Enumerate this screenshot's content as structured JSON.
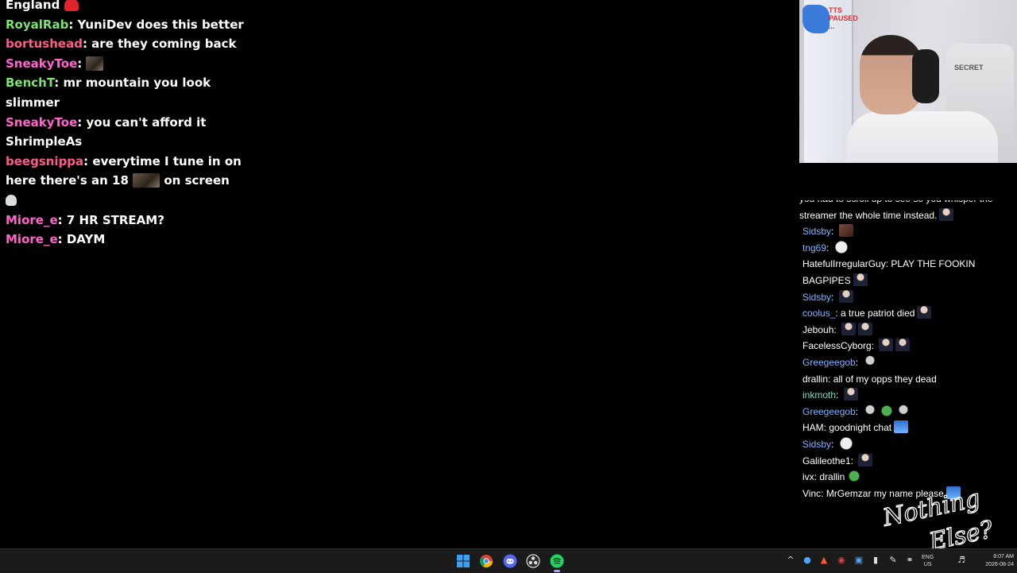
{
  "left_chat": [
    {
      "user": "",
      "user_color": "#ffffff",
      "text": "England",
      "emote": "heart"
    },
    {
      "user": "RoyalRab",
      "user_color": "#7ee36e",
      "text": "YuniDev does this better"
    },
    {
      "user": "bortushead",
      "user_color": "#ff5b8a",
      "text": "are they coming back"
    },
    {
      "user": "SneakyToe",
      "user_color": "#ff66cc",
      "text": "",
      "emote": "image"
    },
    {
      "user": "BenchT",
      "user_color": "#7ee36e",
      "text": "mr mountain you look slimmer"
    },
    {
      "user": "SneakyToe",
      "user_color": "#ff66cc",
      "text": "you can't afford it ShrimpleAs"
    },
    {
      "user": "beegsnippa",
      "user_color": "#ff5b8a",
      "text_before": "everytime I tune in on here there's an 18",
      "text_after": "on screen",
      "emote": "image-skull"
    },
    {
      "user": "Miore_e",
      "user_color": "#ff66cc",
      "text": "7 HR STREAM?"
    },
    {
      "user": "Miore_e",
      "user_color": "#ff66cc",
      "text": "DAYM"
    }
  ],
  "webcam": {
    "overlay_text": "TTS\nPAUSED\n...",
    "chair_brand": "SECRET"
  },
  "right_chat": [
    {
      "user": "",
      "text": "you had to scroll up to see so you whisper the streamer the whole time instead.",
      "emotes": [
        "face-dark"
      ],
      "partial_top": true
    },
    {
      "user": "Sidsby",
      "user_color": "#7fb2ff",
      "text": "",
      "emotes": [
        "pic"
      ]
    },
    {
      "user": "tng69",
      "user_color": "#7fb2ff",
      "text": "",
      "emotes": [
        "face"
      ]
    },
    {
      "user": "HatefulIrregularGuy",
      "user_color": "#ffffff",
      "text": "PLAY THE FOOKIN BAGPIPES",
      "emotes": [
        "face-skin"
      ]
    },
    {
      "user": "Sidsby",
      "user_color": "#7fb2ff",
      "text": "",
      "emotes": [
        "salute"
      ]
    },
    {
      "user": "coolus_",
      "user_color": "#7fb2ff",
      "text": "a true patriot died",
      "emotes": [
        "salute"
      ]
    },
    {
      "user": "Jebouh",
      "user_color": "#ffffff",
      "text": "",
      "emotes": [
        "salute",
        "salute"
      ]
    },
    {
      "user": "FacelessCyborg",
      "user_color": "#ffffff",
      "text": "",
      "emotes": [
        "salute",
        "salute"
      ]
    },
    {
      "user": "Greegeegob",
      "user_color": "#7fb2ff",
      "text": "",
      "emotes": [
        "mic"
      ]
    },
    {
      "user": "drallin",
      "user_color": "#ffffff",
      "text": "all of my opps they dead",
      "emotes": []
    },
    {
      "user": "inkmoth",
      "user_color": "#6fe0c8",
      "text": "",
      "emotes": [
        "salute"
      ]
    },
    {
      "user": "Greegeegob",
      "user_color": "#7fb2ff",
      "text": "",
      "emotes": [
        "mic",
        "frog",
        "mic"
      ]
    },
    {
      "user": "HAM",
      "user_color": "#ffffff",
      "text": "goodnight chat",
      "emotes": [
        "car"
      ]
    },
    {
      "user": "Sidsby",
      "user_color": "#7fb2ff",
      "text": "",
      "emotes": [
        "face"
      ]
    },
    {
      "user": "Galileothe1",
      "user_color": "#ffffff",
      "text": "",
      "emotes": [
        "salute"
      ]
    },
    {
      "user": "ivx",
      "user_color": "#ffffff",
      "text": "drallin",
      "emotes": [
        "frog"
      ]
    },
    {
      "user": "Vinc",
      "user_color": "#ffffff",
      "text": "MrGemzar my name please",
      "emotes": [
        "car"
      ]
    }
  ],
  "watermark": {
    "line1": "Nothing",
    "line2": "Else?"
  },
  "taskbar": {
    "apps": [
      {
        "name": "windows-start",
        "icon": "windows-logo"
      },
      {
        "name": "chrome",
        "icon": "chrome-icon"
      },
      {
        "name": "discord",
        "icon": "discord-icon"
      },
      {
        "name": "obs",
        "icon": "obs-icon"
      },
      {
        "name": "spotify",
        "icon": "spotify-icon",
        "active": true
      }
    ],
    "tray": {
      "lang_line1": "ENG",
      "lang_line2": "US",
      "time": "8:07 AM",
      "date": "2026-08-24"
    }
  }
}
